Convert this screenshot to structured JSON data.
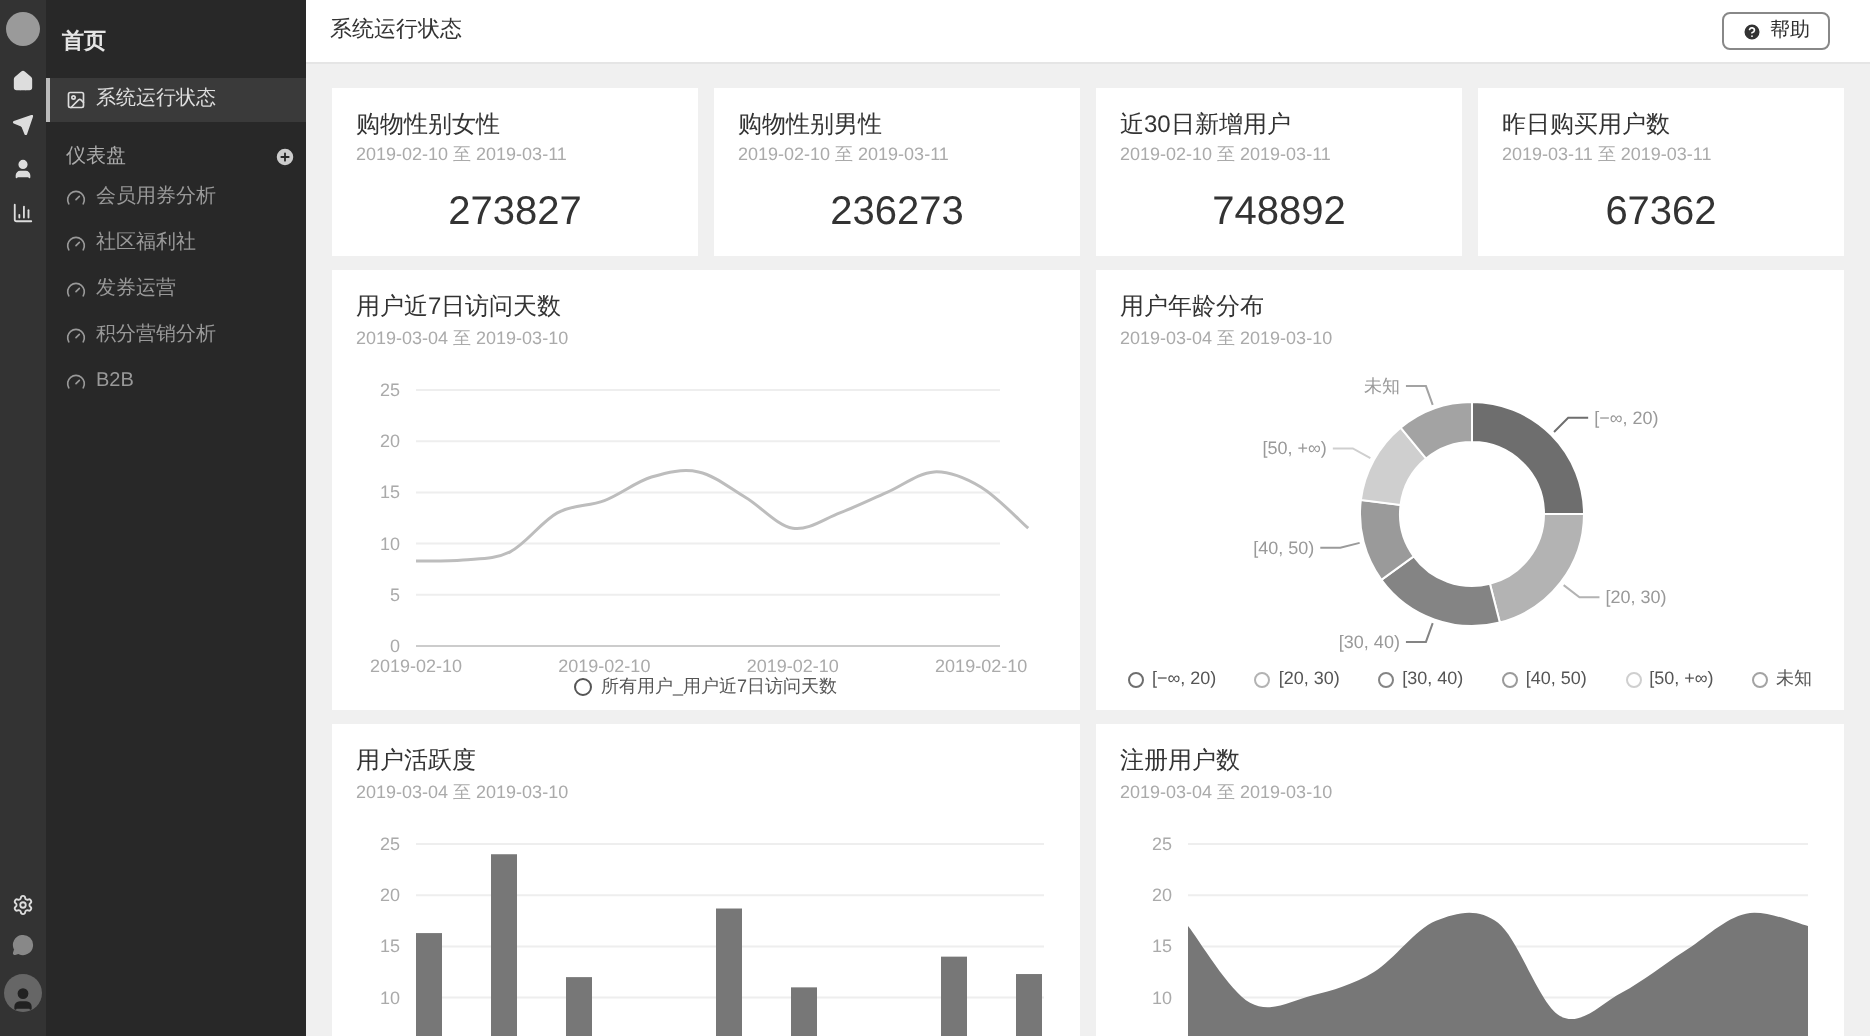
{
  "sidebar": {
    "home": "首页",
    "items": [
      {
        "label": "系统运行状态",
        "selected": true
      }
    ],
    "section": {
      "title": "仪表盘",
      "items": [
        {
          "label": "会员用券分析",
          "selected": false
        },
        {
          "label": "社区福利社",
          "selected": false
        },
        {
          "label": "发券运营",
          "selected": false
        },
        {
          "label": "积分营销分析",
          "selected": false
        },
        {
          "label": "B2B",
          "selected": false
        }
      ]
    }
  },
  "header": {
    "title": "系统运行状态",
    "help_button": "帮助"
  },
  "stats": [
    {
      "title": "购物性别女性",
      "range": "2019-02-10 至 2019-03-11",
      "value": "273827"
    },
    {
      "title": "购物性别男性",
      "range": "2019-02-10 至 2019-03-11",
      "value": "236273"
    },
    {
      "title": "近30日新增用户",
      "range": "2019-02-10 至 2019-03-11",
      "value": "748892"
    },
    {
      "title": "昨日购买用户数",
      "range": "2019-03-11 至 2019-03-11",
      "value": "67362"
    }
  ],
  "charts": [
    {
      "title": "用户近7日访问天数",
      "range": "2019-03-04 至 2019-03-10",
      "chart_data": {
        "type": "line",
        "categories": [
          "2019-02-10",
          null,
          null,
          null,
          "2019-02-10",
          null,
          null,
          null,
          "2019-02-10",
          null,
          null,
          null,
          "2019-02-10",
          null
        ],
        "series": [
          {
            "name": "所有用户_用户近7日访问天数",
            "color": "#bdbdbd",
            "values": [
              8.3,
              8.4,
              9.2,
              13,
              14.2,
              16.5,
              17,
              14.5,
              11.5,
              13,
              15,
              17,
              15.5,
              11.5
            ]
          }
        ],
        "ylim": [
          0,
          25
        ],
        "yticks": [
          0,
          5,
          10,
          15,
          20,
          25
        ],
        "grid": true
      }
    },
    {
      "title": "用户年龄分布",
      "range": "2019-03-04 至 2019-03-10",
      "chart_data": {
        "type": "donut",
        "categories": [
          "[−∞, 20)",
          "[20, 30)",
          "[30, 40)",
          "[40, 50)",
          "[50, +∞)",
          "未知"
        ],
        "values": [
          25,
          21,
          19,
          12,
          12,
          11
        ],
        "colors": [
          "#6e6e6e",
          "#b3b3b3",
          "#848484",
          "#9a9a9a",
          "#cfcfcf",
          "#a3a3a3"
        ]
      }
    },
    {
      "title": "用户活跃度",
      "range": "2019-03-04 至 2019-03-10",
      "chart_data": {
        "type": "bar",
        "categories": [
          null,
          null,
          null,
          null,
          null,
          null,
          null,
          null,
          null
        ],
        "grid": true,
        "series": [
          {
            "color": "#777777",
            "values": [
              16.3,
              24,
              12,
              null,
              18.7,
              11,
              null,
              14,
              12.3
            ]
          }
        ],
        "ylim": [
          0,
          25
        ],
        "yticks": [
          10,
          15,
          20,
          25
        ]
      }
    },
    {
      "title": "注册用户数",
      "range": "2019-03-04 至 2019-03-10",
      "chart_data": {
        "type": "area",
        "categories": [
          null,
          null,
          null,
          null,
          null,
          null,
          null,
          null,
          null,
          null,
          null
        ],
        "grid": true,
        "series": [
          {
            "color": "#777777",
            "values": [
              17,
              9.5,
              10.2,
              12.5,
              17.5,
              17.3,
              8.2,
              10.5,
              14.5,
              18.2,
              17
            ]
          }
        ],
        "ylim": [
          0,
          25
        ],
        "yticks": [
          10,
          15,
          20,
          25
        ]
      }
    }
  ]
}
